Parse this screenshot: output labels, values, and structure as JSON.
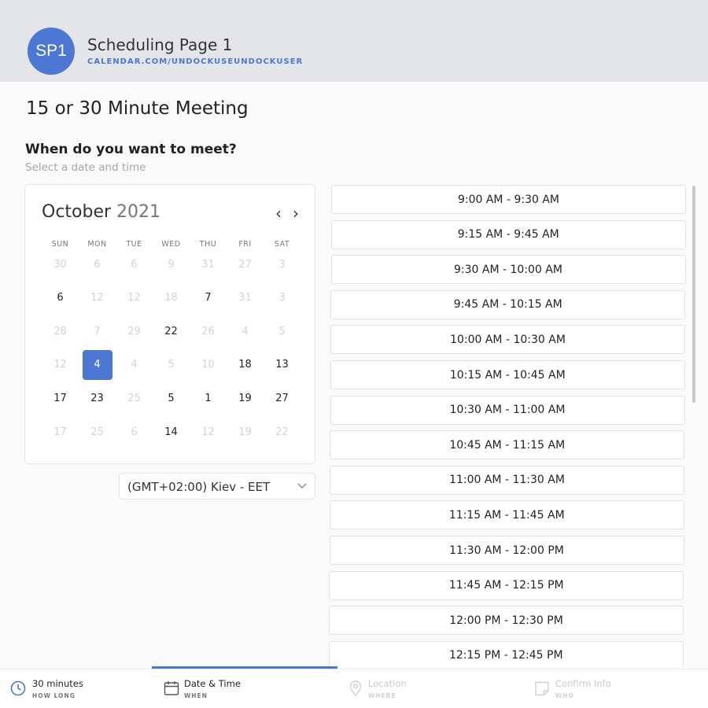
{
  "header": {
    "avatar_initials": "SP1",
    "page_name": "Scheduling Page 1",
    "page_url": "CALENDAR.COM/UNDOCKUSEUNDOCKUSER"
  },
  "meeting": {
    "title": "15 or 30 Minute Meeting",
    "question": "When do you want to meet?",
    "hint": "Select a date and time"
  },
  "calendar": {
    "month": "October",
    "year": "2021",
    "prev_icon": "chevron-left-icon",
    "next_icon": "chevron-right-icon",
    "weekdays": [
      "SUN",
      "MON",
      "TUE",
      "WED",
      "THU",
      "FRI",
      "SAT"
    ],
    "weeks": [
      [
        {
          "label": "30",
          "state": "off"
        },
        {
          "label": "6",
          "state": "off"
        },
        {
          "label": "6",
          "state": "off"
        },
        {
          "label": "9",
          "state": "off"
        },
        {
          "label": "31",
          "state": "off"
        },
        {
          "label": "27",
          "state": "off"
        },
        {
          "label": "3",
          "state": "off"
        }
      ],
      [
        {
          "label": "6",
          "state": "on"
        },
        {
          "label": "12",
          "state": "off"
        },
        {
          "label": "12",
          "state": "off"
        },
        {
          "label": "18",
          "state": "off"
        },
        {
          "label": "7",
          "state": "on"
        },
        {
          "label": "31",
          "state": "off"
        },
        {
          "label": "3",
          "state": "off"
        }
      ],
      [
        {
          "label": "28",
          "state": "off"
        },
        {
          "label": "7",
          "state": "off"
        },
        {
          "label": "29",
          "state": "off"
        },
        {
          "label": "22",
          "state": "on"
        },
        {
          "label": "26",
          "state": "off"
        },
        {
          "label": "4",
          "state": "off"
        },
        {
          "label": "5",
          "state": "off"
        }
      ],
      [
        {
          "label": "12",
          "state": "off"
        },
        {
          "label": "4",
          "state": "sel"
        },
        {
          "label": "4",
          "state": "off"
        },
        {
          "label": "5",
          "state": "off"
        },
        {
          "label": "10",
          "state": "off"
        },
        {
          "label": "18",
          "state": "on"
        },
        {
          "label": "13",
          "state": "on"
        }
      ],
      [
        {
          "label": "17",
          "state": "on"
        },
        {
          "label": "23",
          "state": "on"
        },
        {
          "label": "25",
          "state": "off"
        },
        {
          "label": "5",
          "state": "on"
        },
        {
          "label": "1",
          "state": "on"
        },
        {
          "label": "19",
          "state": "on"
        },
        {
          "label": "27",
          "state": "on"
        }
      ],
      [
        {
          "label": "17",
          "state": "off"
        },
        {
          "label": "25",
          "state": "off"
        },
        {
          "label": "6",
          "state": "off"
        },
        {
          "label": "14",
          "state": "on"
        },
        {
          "label": "12",
          "state": "off"
        },
        {
          "label": "19",
          "state": "off"
        },
        {
          "label": "22",
          "state": "off"
        }
      ]
    ]
  },
  "timezone": {
    "value": "(GMT+02:00) Kiev - EET",
    "icon": "chevron-down-icon"
  },
  "time_slots": [
    "9:00 AM - 9:30 AM",
    "9:15 AM - 9:45 AM",
    "9:30 AM - 10:00 AM",
    "9:45 AM - 10:15 AM",
    "10:00 AM - 10:30 AM",
    "10:15 AM - 10:45 AM",
    "10:30 AM - 11:00 AM",
    "10:45 AM - 11:15 AM",
    "11:00 AM - 11:30 AM",
    "11:15 AM - 11:45 AM",
    "11:30 AM - 12:00 PM",
    "11:45 AM - 12:15 PM",
    "12:00 PM - 12:30 PM",
    "12:15 PM - 12:45 PM"
  ],
  "steps": [
    {
      "title": "30 minutes",
      "sub": "HOW LONG",
      "icon": "clock-icon",
      "state": "active"
    },
    {
      "title": "Date & Time",
      "sub": "WHEN",
      "icon": "calendar-icon",
      "state": "active"
    },
    {
      "title": "Location",
      "sub": "WHERE",
      "icon": "location-pin-icon",
      "state": "inactive"
    },
    {
      "title": "Confirm Info",
      "sub": "WHO",
      "icon": "note-icon",
      "state": "inactive"
    }
  ],
  "colors": {
    "accent": "#4c77d4",
    "header_bg": "#e4e5e9",
    "page_bg": "#fafafa",
    "disabled_day": "#d0d3da"
  }
}
